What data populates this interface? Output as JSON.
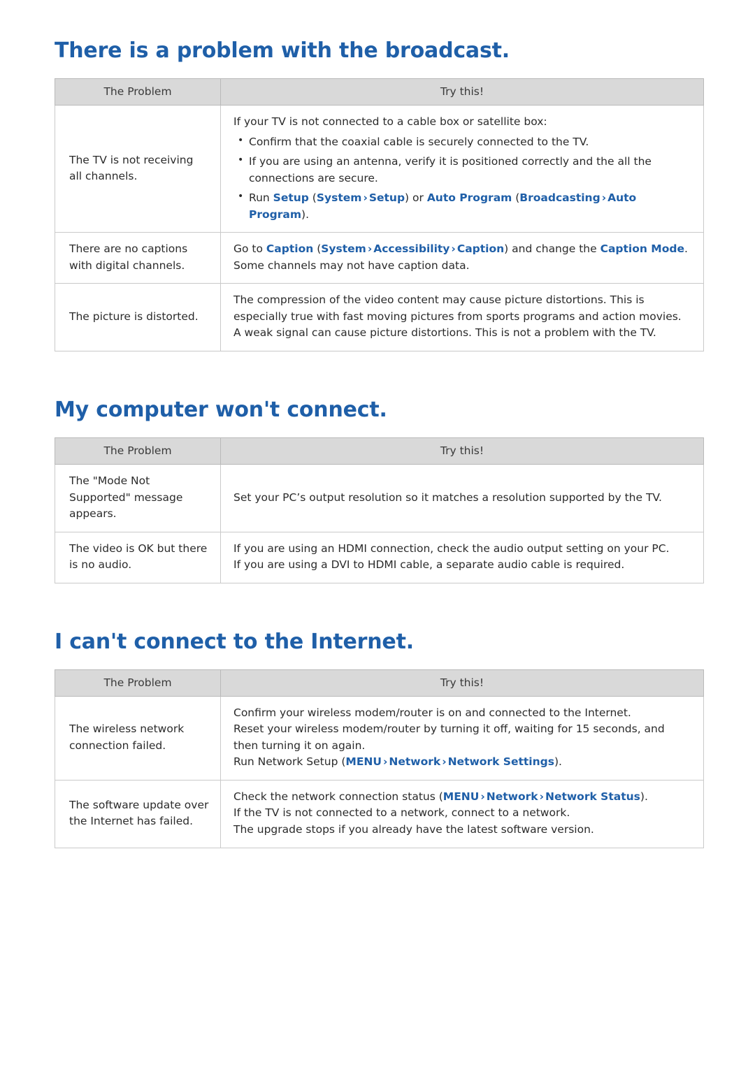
{
  "sections": [
    {
      "title": "There is a problem with the broadcast.",
      "headers": {
        "problem": "The Problem",
        "try": "Try this!"
      },
      "rows": [
        {
          "problem": "The TV is not receiving all channels.",
          "lead": "If your TV is not connected to a cable box or satellite box:",
          "bullets": [
            "Confirm that the coaxial cable is securely connected to the TV.",
            "If you are using an antenna, verify it is positioned correctly and the all the connections are secure."
          ],
          "bullet_rich": {
            "prefix": "Run ",
            "t1": "Setup",
            "p1": " (",
            "t2": "System",
            "a1": "›",
            "t3": "Setup",
            "p2": ") or ",
            "t4": "Auto Program",
            "p3": " (",
            "t5": "Broadcasting",
            "a2": "›",
            "t6": "Auto Program",
            "suffix": ")."
          }
        },
        {
          "problem": "There are no captions with digital channels.",
          "rich_line1": {
            "prefix": "Go to ",
            "t1": "Caption",
            "p1": " (",
            "t2": "System",
            "a1": "›",
            "t3": "Accessibility",
            "a2": "›",
            "t4": "Caption",
            "p2": ") and change the ",
            "t5": "Caption Mode",
            "suffix": "."
          },
          "line2": "Some channels may not have caption data."
        },
        {
          "problem": "The picture is distorted.",
          "plain": [
            "The compression of the video content may cause picture distortions. This is especially true with fast moving pictures from sports programs and action movies.",
            "A weak signal can cause picture distortions. This is not a problem with the TV."
          ]
        }
      ]
    },
    {
      "title": "My computer won't connect.",
      "headers": {
        "problem": "The Problem",
        "try": "Try this!"
      },
      "rows": [
        {
          "problem": "The \"Mode Not Supported\" message appears.",
          "plain": [
            "Set your PC’s output resolution so it matches a resolution supported by the TV."
          ]
        },
        {
          "problem": "The video is OK but there is no audio.",
          "plain": [
            "If you are using an HDMI connection, check the audio output setting on your PC.",
            "If you are using a DVI to HDMI cable, a separate audio cable is required."
          ]
        }
      ]
    },
    {
      "title": "I can't connect to the Internet.",
      "headers": {
        "problem": "The Problem",
        "try": "Try this!"
      },
      "rows": [
        {
          "problem": "The wireless network connection failed.",
          "plain": [
            "Confirm your wireless modem/router is on and connected to the Internet.",
            "Reset your wireless modem/router by turning it off, waiting for 15 seconds, and then turning it on again."
          ],
          "rich_line3": {
            "prefix": "Run Network Setup (",
            "t1": "MENU",
            "a1": "›",
            "t2": "Network",
            "a2": "›",
            "t3": "Network Settings",
            "suffix": ")."
          }
        },
        {
          "problem": "The software update over the Internet has failed.",
          "rich_line1": {
            "prefix": "Check the network connection status (",
            "t1": "MENU",
            "a1": "›",
            "t2": "Network",
            "a2": "›",
            "t3": "Network Status",
            "suffix": ")."
          },
          "plain": [
            "If the TV is not connected to a network, connect to a network.",
            "The upgrade stops if you already have the latest software version."
          ]
        }
      ]
    }
  ],
  "colors": {
    "accent": "#1f5fa8",
    "header_bg": "#d9d9d9",
    "text": "#2b2b2b"
  }
}
